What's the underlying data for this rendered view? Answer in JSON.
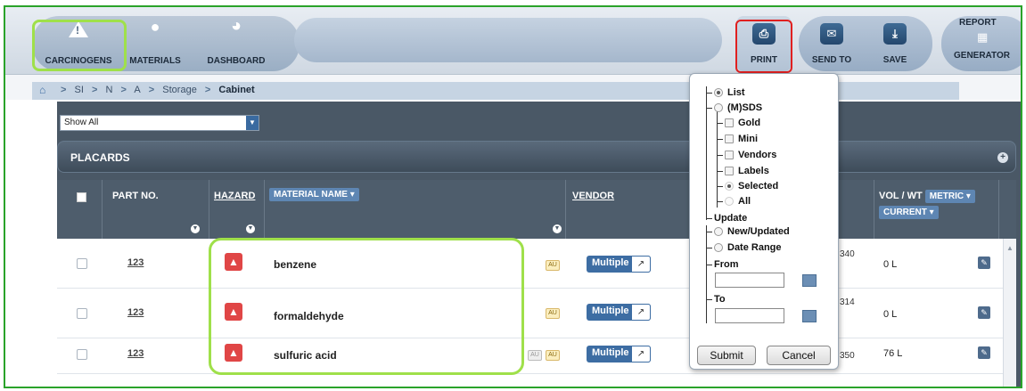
{
  "toolbar": {
    "carcinogens_label": "CARCINOGENS",
    "materials_label": "MATERIALS",
    "dashboard_label": "DASHBOARD",
    "print_label": "PRINT",
    "send_label": "SEND TO",
    "save_label": "SAVE",
    "report_top": "REPORT",
    "report_bottom": "GENERATOR"
  },
  "breadcrumb": {
    "items": [
      "SI",
      "N",
      "A",
      "Storage"
    ],
    "current": "Cabinet"
  },
  "filter": {
    "value": "Show All"
  },
  "section_title": "PLACARDS",
  "table": {
    "headers": {
      "part_no": "PART NO.",
      "hazard": "HAZARD",
      "material_name": "MATERIAL NAME",
      "vendor": "VENDOR",
      "vol_wt": "VOL / WT",
      "metric": "METRIC",
      "current": "CURRENT"
    },
    "rows": [
      {
        "part_icon": "123",
        "name": "benzene",
        "vendor": "Multiple",
        "num": "340",
        "vol": "0 L"
      },
      {
        "part_icon": "123",
        "name": "formaldehyde",
        "vendor": "Multiple",
        "num": "314",
        "vol": "0 L"
      },
      {
        "part_icon": "123",
        "name": "sulfuric acid",
        "vendor": "Multiple",
        "num": "350",
        "vol": "76 L"
      }
    ]
  },
  "print_popup": {
    "list": "List",
    "msds": "(M)SDS",
    "gold": "Gold",
    "mini": "Mini",
    "vendors": "Vendors",
    "labels": "Labels",
    "selected": "Selected",
    "all": "All",
    "update": "Update",
    "new_updated": "New/Updated",
    "date_range": "Date Range",
    "from": "From",
    "to": "To",
    "submit": "Submit",
    "cancel": "Cancel"
  },
  "colors": {
    "highlight_green": "#9fe04a",
    "highlight_red": "#e02020",
    "hazard_red": "#e04646",
    "vendor_blue": "#3d6da3"
  },
  "icons": [
    "hazard-triangle-icon",
    "molecule-icon",
    "pie-chart-icon",
    "printer-icon",
    "envelope-icon",
    "download-icon",
    "report-icon",
    "home-icon",
    "funnel-icon",
    "expand-icon",
    "edit-icon",
    "calendar-icon",
    "add-icon"
  ]
}
